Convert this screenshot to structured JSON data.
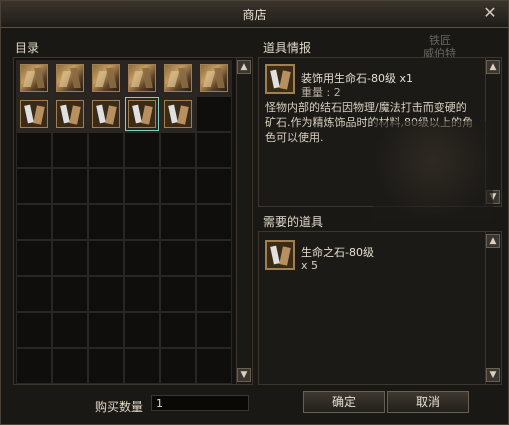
{
  "window": {
    "title": "商店",
    "close_symbol": "✕"
  },
  "catalog": {
    "label": "目录",
    "items": [
      {
        "kind": "ore"
      },
      {
        "kind": "ore"
      },
      {
        "kind": "ore"
      },
      {
        "kind": "ore"
      },
      {
        "kind": "ore"
      },
      {
        "kind": "ore"
      },
      {
        "kind": "stone"
      },
      {
        "kind": "stone"
      },
      {
        "kind": "stone"
      },
      {
        "kind": "stone",
        "selected": true
      },
      {
        "kind": "stone"
      }
    ],
    "total_slots": 54
  },
  "item_info": {
    "label": "道具情报",
    "name": "装饰用生命石-80级 x1",
    "weight": "重量 : 2",
    "description": "怪物内部的结石因物理/魔法打击而变硬的矿石.作为精炼饰品时的材料,80级以上的角色可以使用."
  },
  "required": {
    "label": "需要的道具",
    "name": "生命之石-80级",
    "qty": "x 5"
  },
  "purchase": {
    "qty_label": "购买数量",
    "qty_value": "1",
    "confirm_label": "确定",
    "cancel_label": "取消"
  },
  "background": {
    "npc_line1": "铁匠",
    "npc_line2": "威伯特"
  },
  "icons": {
    "scroll_up": "▲",
    "scroll_down": "▼"
  }
}
